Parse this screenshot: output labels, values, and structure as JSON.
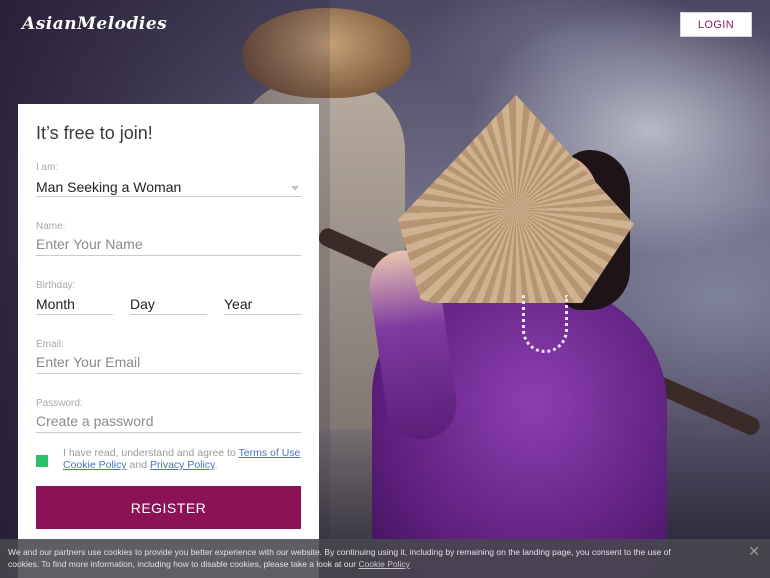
{
  "brand": {
    "logo_text": "AsianMelodies"
  },
  "header": {
    "login_label": "LOGIN"
  },
  "signup": {
    "title": "It’s free to join!",
    "i_am": {
      "label": "I am:",
      "value": "Man Seeking a Woman"
    },
    "name": {
      "label": "Name:",
      "placeholder": "Enter Your Name"
    },
    "birthday": {
      "label": "Birthday:",
      "month": "Month",
      "day": "Day",
      "year": "Year"
    },
    "email": {
      "label": "Email:",
      "placeholder": "Enter Your Email"
    },
    "password": {
      "label": "Password:",
      "placeholder": "Create a password"
    },
    "terms": {
      "prefix": "I have read, understand and agree to ",
      "terms_link": "Terms of Use",
      "cookie_link": "Cookie Policy",
      "and": " and ",
      "privacy_link": "Privacy Policy",
      "suffix": ".",
      "checked": true
    },
    "register_label": "REGISTER"
  },
  "cookie_notice": {
    "text": "We and our partners use cookies to provide you better experience with our website. By continuing using it, including by remaining on the landing page, you consent to the use of cookies. To find more information, including how to disable cookies, please take a look at our ",
    "link": "Cookie Policy",
    "close_glyph": "✕"
  },
  "colors": {
    "accent": "#8c1256",
    "login_text": "#8f1b5d",
    "checkbox": "#2ebd6b",
    "link": "#4a73c4"
  }
}
